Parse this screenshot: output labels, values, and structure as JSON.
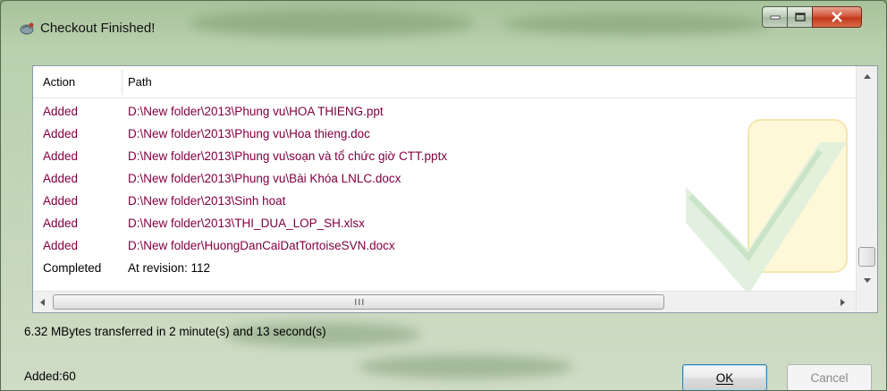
{
  "window": {
    "title": "Checkout Finished!"
  },
  "table": {
    "columns": [
      "Action",
      "Path"
    ],
    "rows": [
      {
        "action": "Added",
        "path": "D:\\New folder\\2013\\Phung vu\\HOA THIENG.ppt",
        "kind": "added"
      },
      {
        "action": "Added",
        "path": "D:\\New folder\\2013\\Phung vu\\Hoa thieng.doc",
        "kind": "added"
      },
      {
        "action": "Added",
        "path": "D:\\New folder\\2013\\Phung vu\\soạn và tổ chức giờ CTT.pptx",
        "kind": "added"
      },
      {
        "action": "Added",
        "path": "D:\\New folder\\2013\\Phung vu\\Bài Khóa LNLC.docx",
        "kind": "added"
      },
      {
        "action": "Added",
        "path": "D:\\New folder\\2013\\Sinh hoat",
        "kind": "added"
      },
      {
        "action": "Added",
        "path": "D:\\New folder\\2013\\THI_DUA_LOP_SH.xlsx",
        "kind": "added"
      },
      {
        "action": "Added",
        "path": "D:\\New folder\\HuongDanCaiDatTortoiseSVN.docx",
        "kind": "added"
      },
      {
        "action": "Completed",
        "path": "At revision: 112",
        "kind": "completed"
      }
    ]
  },
  "status": {
    "transfer": "6.32 MBytes transferred in 2 minute(s) and 13 second(s)",
    "added_count": "Added:60"
  },
  "buttons": {
    "ok": "OK",
    "cancel": "Cancel"
  },
  "colors": {
    "added": "#800040",
    "completed": "#000000"
  },
  "icons": {
    "title": "tortoisesvn-icon",
    "minimize": "minimize-icon",
    "maximize": "maximize-icon",
    "close": "close-icon"
  }
}
